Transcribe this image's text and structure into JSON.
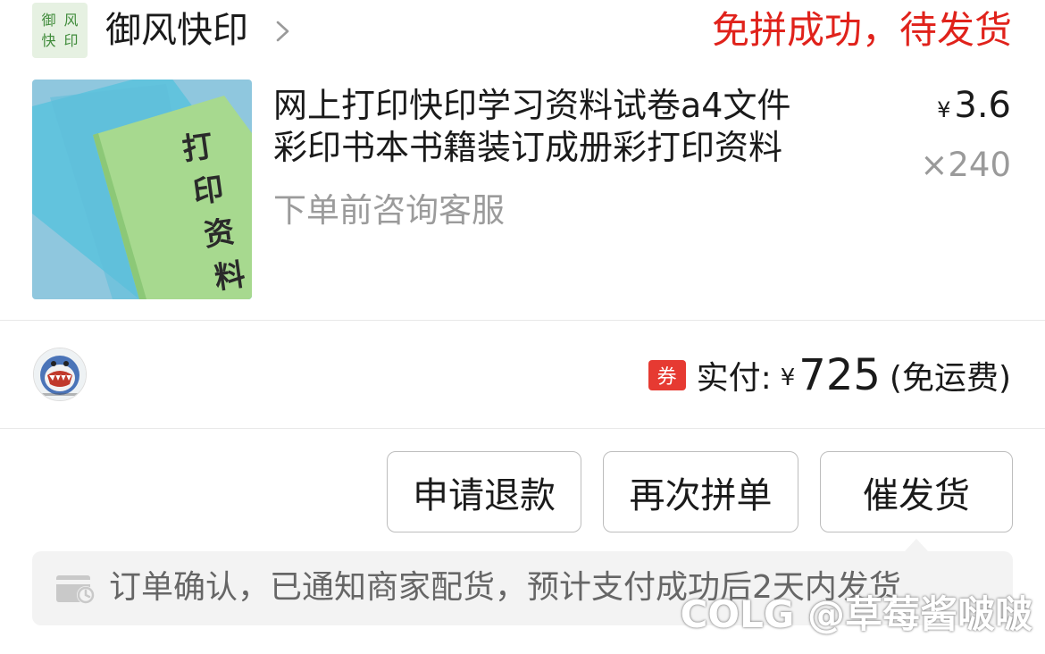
{
  "shop": {
    "logo_chars": [
      "御",
      "风",
      "快",
      "印"
    ],
    "name": "御风快印",
    "chevron_icon": "chevron-right-icon",
    "status": "免拼成功，待发货"
  },
  "product": {
    "thumbnail_text": [
      "打",
      "印",
      "资",
      "料"
    ],
    "title_line1": "网上打印快印学习资料试卷a4文件",
    "title_line2": "彩印书本书籍装订成册彩打印资料",
    "note": "下单前咨询客服",
    "price_symbol": "¥",
    "price": "3.6",
    "quantity": "×240"
  },
  "payment": {
    "coupon_badge": "券",
    "label": "实付:",
    "currency": "¥",
    "amount": "725",
    "shipping": "(免运费)"
  },
  "actions": {
    "refund": "申请退款",
    "regroup": "再次拼单",
    "urge": "催发货"
  },
  "notice": {
    "icon": "wallet-clock-icon",
    "text": "订单确认，已通知商家配货，预计支付成功后2天内发货"
  },
  "watermark": "COLG @草莓酱啵啵",
  "colors": {
    "status_red": "#e0221b",
    "coupon_red": "#e63a32",
    "notice_bg": "#f3f3f3",
    "muted_text": "#9b9b9b"
  }
}
